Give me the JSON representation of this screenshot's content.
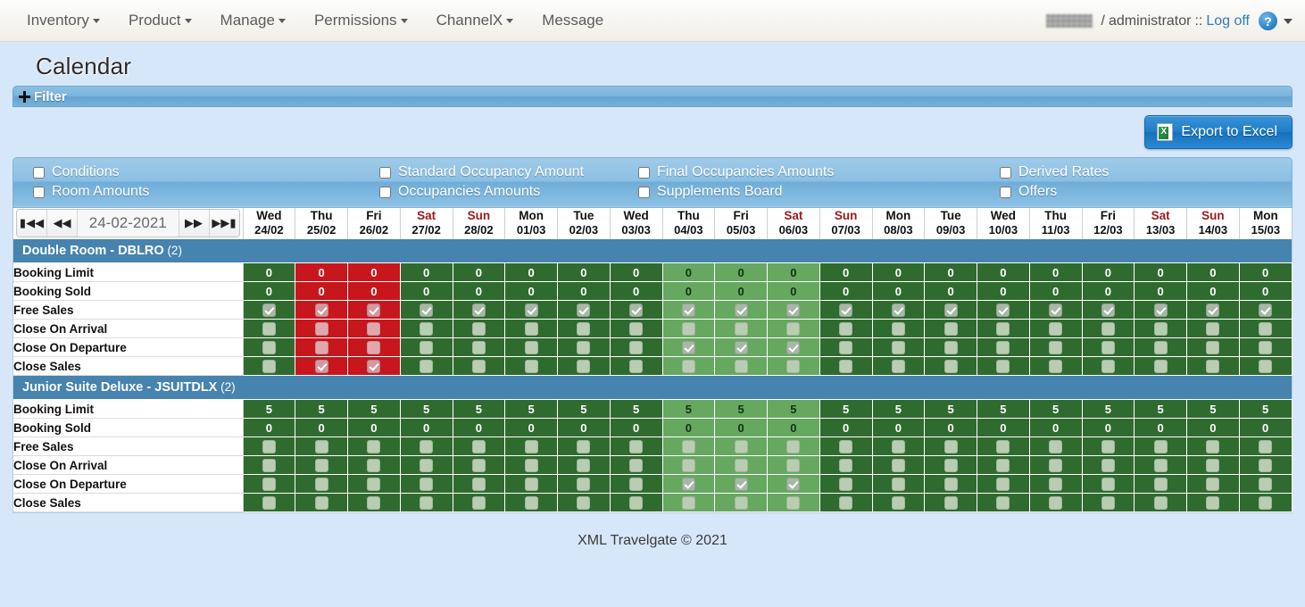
{
  "navbar": {
    "items": [
      {
        "label": "Inventory",
        "has_caret": true
      },
      {
        "label": "Product",
        "has_caret": true
      },
      {
        "label": "Manage",
        "has_caret": true
      },
      {
        "label": "Permissions",
        "has_caret": true
      },
      {
        "label": "ChannelX",
        "has_caret": true
      },
      {
        "label": "Message",
        "has_caret": false
      }
    ],
    "user": {
      "account": "",
      "separator": "/",
      "role": "administrator",
      "role_separator": "::",
      "logoff_label": "Log off",
      "help_label": "?"
    }
  },
  "page": {
    "title": "Calendar",
    "filter_label": "Filter",
    "export_label": "Export to Excel",
    "footer": "XML Travelgate © 2021"
  },
  "options": [
    {
      "label": "Conditions",
      "checked": false
    },
    {
      "label": "Room Amounts",
      "checked": false
    },
    {
      "label": "Standard Occupancy Amount",
      "checked": false
    },
    {
      "label": "Occupancies Amounts",
      "checked": false
    },
    {
      "label": "Final Occupancies Amounts",
      "checked": false
    },
    {
      "label": "Supplements Board",
      "checked": false
    },
    {
      "label": "Derived Rates",
      "checked": false
    },
    {
      "label": "Offers",
      "checked": false
    }
  ],
  "datenav": {
    "first_label": "first",
    "prev_label": "prev",
    "value": "24-02-2021",
    "next_label": "next",
    "last_label": "last"
  },
  "days": [
    {
      "dow": "Wed",
      "date": "24/02",
      "weekend": false,
      "tint": "g"
    },
    {
      "dow": "Thu",
      "date": "25/02",
      "weekend": false,
      "tint": "r"
    },
    {
      "dow": "Fri",
      "date": "26/02",
      "weekend": false,
      "tint": "r"
    },
    {
      "dow": "Sat",
      "date": "27/02",
      "weekend": true,
      "tint": "g"
    },
    {
      "dow": "Sun",
      "date": "28/02",
      "weekend": true,
      "tint": "g"
    },
    {
      "dow": "Mon",
      "date": "01/03",
      "weekend": false,
      "tint": "g"
    },
    {
      "dow": "Tue",
      "date": "02/03",
      "weekend": false,
      "tint": "g"
    },
    {
      "dow": "Wed",
      "date": "03/03",
      "weekend": false,
      "tint": "g"
    },
    {
      "dow": "Thu",
      "date": "04/03",
      "weekend": false,
      "tint": "gl"
    },
    {
      "dow": "Fri",
      "date": "05/03",
      "weekend": false,
      "tint": "gl"
    },
    {
      "dow": "Sat",
      "date": "06/03",
      "weekend": true,
      "tint": "gl"
    },
    {
      "dow": "Sun",
      "date": "07/03",
      "weekend": true,
      "tint": "g"
    },
    {
      "dow": "Mon",
      "date": "08/03",
      "weekend": false,
      "tint": "g"
    },
    {
      "dow": "Tue",
      "date": "09/03",
      "weekend": false,
      "tint": "g"
    },
    {
      "dow": "Wed",
      "date": "10/03",
      "weekend": false,
      "tint": "g"
    },
    {
      "dow": "Thu",
      "date": "11/03",
      "weekend": false,
      "tint": "g"
    },
    {
      "dow": "Fri",
      "date": "12/03",
      "weekend": false,
      "tint": "g"
    },
    {
      "dow": "Sat",
      "date": "13/03",
      "weekend": true,
      "tint": "g"
    },
    {
      "dow": "Sun",
      "date": "14/03",
      "weekend": true,
      "tint": "g"
    },
    {
      "dow": "Mon",
      "date": "15/03",
      "weekend": false,
      "tint": "g"
    }
  ],
  "groups": [
    {
      "name": "Double Room - DBLRO",
      "count": "(2)",
      "rows": [
        {
          "label": "Booking Limit",
          "type": "value",
          "values": [
            "0",
            "0",
            "0",
            "0",
            "0",
            "0",
            "0",
            "0",
            "0",
            "0",
            "0",
            "0",
            "0",
            "0",
            "0",
            "0",
            "0",
            "0",
            "0",
            "0"
          ]
        },
        {
          "label": "Booking Sold",
          "type": "value",
          "values": [
            "0",
            "0",
            "0",
            "0",
            "0",
            "0",
            "0",
            "0",
            "0",
            "0",
            "0",
            "0",
            "0",
            "0",
            "0",
            "0",
            "0",
            "0",
            "0",
            "0"
          ]
        },
        {
          "label": "Free Sales",
          "type": "check",
          "values": [
            1,
            1,
            1,
            1,
            1,
            1,
            1,
            1,
            1,
            1,
            1,
            1,
            1,
            1,
            1,
            1,
            1,
            1,
            1,
            1
          ]
        },
        {
          "label": "Close On Arrival",
          "type": "check",
          "values": [
            0,
            0,
            0,
            0,
            0,
            0,
            0,
            0,
            0,
            0,
            0,
            0,
            0,
            0,
            0,
            0,
            0,
            0,
            0,
            0
          ]
        },
        {
          "label": "Close On Departure",
          "type": "check",
          "values": [
            0,
            0,
            0,
            0,
            0,
            0,
            0,
            0,
            1,
            1,
            1,
            0,
            0,
            0,
            0,
            0,
            0,
            0,
            0,
            0
          ]
        },
        {
          "label": "Close Sales",
          "type": "check",
          "values": [
            0,
            1,
            1,
            0,
            0,
            0,
            0,
            0,
            0,
            0,
            0,
            0,
            0,
            0,
            0,
            0,
            0,
            0,
            0,
            0
          ]
        }
      ]
    },
    {
      "name": "Junior Suite Deluxe - JSUITDLX",
      "count": "(2)",
      "rows": [
        {
          "label": "Booking Limit",
          "type": "value",
          "values": [
            "5",
            "5",
            "5",
            "5",
            "5",
            "5",
            "5",
            "5",
            "5",
            "5",
            "5",
            "5",
            "5",
            "5",
            "5",
            "5",
            "5",
            "5",
            "5",
            "5"
          ]
        },
        {
          "label": "Booking Sold",
          "type": "value",
          "values": [
            "0",
            "0",
            "0",
            "0",
            "0",
            "0",
            "0",
            "0",
            "0",
            "0",
            "0",
            "0",
            "0",
            "0",
            "0",
            "0",
            "0",
            "0",
            "0",
            "0"
          ]
        },
        {
          "label": "Free Sales",
          "type": "check",
          "values": [
            0,
            0,
            0,
            0,
            0,
            0,
            0,
            0,
            0,
            0,
            0,
            0,
            0,
            0,
            0,
            0,
            0,
            0,
            0,
            0
          ]
        },
        {
          "label": "Close On Arrival",
          "type": "check",
          "values": [
            0,
            0,
            0,
            0,
            0,
            0,
            0,
            0,
            0,
            0,
            0,
            0,
            0,
            0,
            0,
            0,
            0,
            0,
            0,
            0
          ]
        },
        {
          "label": "Close On Departure",
          "type": "check",
          "values": [
            0,
            0,
            0,
            0,
            0,
            0,
            0,
            0,
            1,
            1,
            1,
            0,
            0,
            0,
            0,
            0,
            0,
            0,
            0,
            0
          ]
        },
        {
          "label": "Close Sales",
          "type": "check",
          "values": [
            0,
            0,
            0,
            0,
            0,
            0,
            0,
            0,
            0,
            0,
            0,
            0,
            0,
            0,
            0,
            0,
            0,
            0,
            0,
            0
          ]
        }
      ]
    }
  ],
  "group_tints": [
    [
      "g",
      "r",
      "r",
      "g",
      "g",
      "g",
      "g",
      "g",
      "gl",
      "gl",
      "gl",
      "g",
      "g",
      "g",
      "g",
      "g",
      "g",
      "g",
      "g",
      "g"
    ],
    [
      "g",
      "g",
      "g",
      "g",
      "g",
      "g",
      "g",
      "g",
      "gl",
      "gl",
      "gl",
      "g",
      "g",
      "g",
      "g",
      "g",
      "g",
      "g",
      "g",
      "g"
    ]
  ],
  "colors": {
    "green": "#2f6b2f",
    "green_light": "#66a860",
    "red": "#c8161d",
    "group_header": "#4683af",
    "page_bg": "#d6e7fa",
    "accent_blue": "#1f7cc6"
  }
}
